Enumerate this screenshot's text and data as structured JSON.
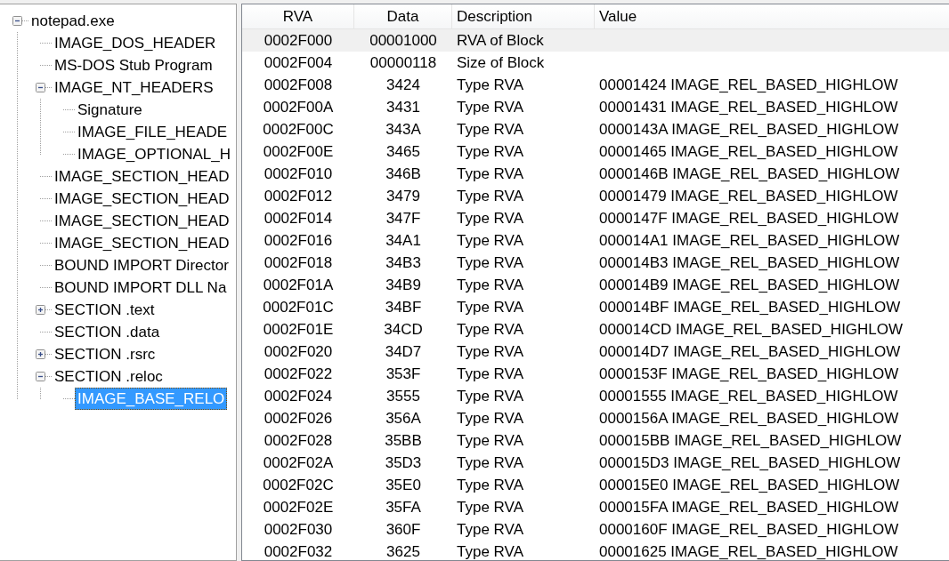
{
  "tree": [
    {
      "label": "notepad.exe",
      "expanded": true,
      "selected": false,
      "children": [
        {
          "label": "IMAGE_DOS_HEADER",
          "selected": false
        },
        {
          "label": "MS-DOS Stub Program",
          "selected": false
        },
        {
          "label": "IMAGE_NT_HEADERS",
          "expanded": true,
          "selected": false,
          "children": [
            {
              "label": "Signature",
              "selected": false
            },
            {
              "label": "IMAGE_FILE_HEADE",
              "selected": false
            },
            {
              "label": "IMAGE_OPTIONAL_H",
              "selected": false
            }
          ]
        },
        {
          "label": "IMAGE_SECTION_HEAD",
          "selected": false
        },
        {
          "label": "IMAGE_SECTION_HEAD",
          "selected": false
        },
        {
          "label": "IMAGE_SECTION_HEAD",
          "selected": false
        },
        {
          "label": "IMAGE_SECTION_HEAD",
          "selected": false
        },
        {
          "label": "BOUND IMPORT Director",
          "selected": false
        },
        {
          "label": "BOUND IMPORT DLL Na",
          "selected": false
        },
        {
          "label": "SECTION .text",
          "expanded": false,
          "selected": false
        },
        {
          "label": "SECTION .data",
          "selected": false
        },
        {
          "label": "SECTION .rsrc",
          "expanded": false,
          "selected": false
        },
        {
          "label": "SECTION .reloc",
          "expanded": true,
          "selected": false,
          "children": [
            {
              "label": "IMAGE_BASE_RELO",
              "selected": true
            }
          ]
        }
      ]
    }
  ],
  "table": {
    "columns": [
      "RVA",
      "Data",
      "Description",
      "Value"
    ],
    "rows": [
      {
        "rva": "0002F000",
        "data": "00001000",
        "description": "RVA of Block",
        "selected": true
      },
      {
        "rva": "0002F004",
        "data": "00000118",
        "description": "Size of Block",
        "selected": false
      },
      {
        "rva": "0002F008",
        "data": "3424",
        "description": "Type RVA",
        "value": "00001424 IMAGE_REL_BASED_HIGHLOW",
        "selected": false
      },
      {
        "rva": "0002F00A",
        "data": "3431",
        "description": "Type RVA",
        "value": "00001431 IMAGE_REL_BASED_HIGHLOW",
        "selected": false
      },
      {
        "rva": "0002F00C",
        "data": "343A",
        "description": "Type RVA",
        "value": "0000143A IMAGE_REL_BASED_HIGHLOW",
        "selected": false
      },
      {
        "rva": "0002F00E",
        "data": "3465",
        "description": "Type RVA",
        "value": "00001465 IMAGE_REL_BASED_HIGHLOW",
        "selected": false
      },
      {
        "rva": "0002F010",
        "data": "346B",
        "description": "Type RVA",
        "value": "0000146B IMAGE_REL_BASED_HIGHLOW",
        "selected": false
      },
      {
        "rva": "0002F012",
        "data": "3479",
        "description": "Type RVA",
        "value": "00001479 IMAGE_REL_BASED_HIGHLOW",
        "selected": false
      },
      {
        "rva": "0002F014",
        "data": "347F",
        "description": "Type RVA",
        "value": "0000147F IMAGE_REL_BASED_HIGHLOW",
        "selected": false
      },
      {
        "rva": "0002F016",
        "data": "34A1",
        "description": "Type RVA",
        "value": "000014A1 IMAGE_REL_BASED_HIGHLOW",
        "selected": false
      },
      {
        "rva": "0002F018",
        "data": "34B3",
        "description": "Type RVA",
        "value": "000014B3 IMAGE_REL_BASED_HIGHLOW",
        "selected": false
      },
      {
        "rva": "0002F01A",
        "data": "34B9",
        "description": "Type RVA",
        "value": "000014B9 IMAGE_REL_BASED_HIGHLOW",
        "selected": false
      },
      {
        "rva": "0002F01C",
        "data": "34BF",
        "description": "Type RVA",
        "value": "000014BF IMAGE_REL_BASED_HIGHLOW",
        "selected": false
      },
      {
        "rva": "0002F01E",
        "data": "34CD",
        "description": "Type RVA",
        "value": "000014CD IMAGE_REL_BASED_HIGHLOW",
        "selected": false
      },
      {
        "rva": "0002F020",
        "data": "34D7",
        "description": "Type RVA",
        "value": "000014D7 IMAGE_REL_BASED_HIGHLOW",
        "selected": false
      },
      {
        "rva": "0002F022",
        "data": "353F",
        "description": "Type RVA",
        "value": "0000153F IMAGE_REL_BASED_HIGHLOW",
        "selected": false
      },
      {
        "rva": "0002F024",
        "data": "3555",
        "description": "Type RVA",
        "value": "00001555 IMAGE_REL_BASED_HIGHLOW",
        "selected": false
      },
      {
        "rva": "0002F026",
        "data": "356A",
        "description": "Type RVA",
        "value": "0000156A IMAGE_REL_BASED_HIGHLOW",
        "selected": false
      },
      {
        "rva": "0002F028",
        "data": "35BB",
        "description": "Type RVA",
        "value": "000015BB IMAGE_REL_BASED_HIGHLOW",
        "selected": false
      },
      {
        "rva": "0002F02A",
        "data": "35D3",
        "description": "Type RVA",
        "value": "000015D3 IMAGE_REL_BASED_HIGHLOW",
        "selected": false
      },
      {
        "rva": "0002F02C",
        "data": "35E0",
        "description": "Type RVA",
        "value": "000015E0 IMAGE_REL_BASED_HIGHLOW",
        "selected": false
      },
      {
        "rva": "0002F02E",
        "data": "35FA",
        "description": "Type RVA",
        "value": "000015FA IMAGE_REL_BASED_HIGHLOW",
        "selected": false
      },
      {
        "rva": "0002F030",
        "data": "360F",
        "description": "Type RVA",
        "value": "0000160F IMAGE_REL_BASED_HIGHLOW",
        "selected": false
      },
      {
        "rva": "0002F032",
        "data": "3625",
        "description": "Type RVA",
        "value": "00001625 IMAGE_REL_BASED_HIGHLOW",
        "selected": false
      }
    ]
  }
}
